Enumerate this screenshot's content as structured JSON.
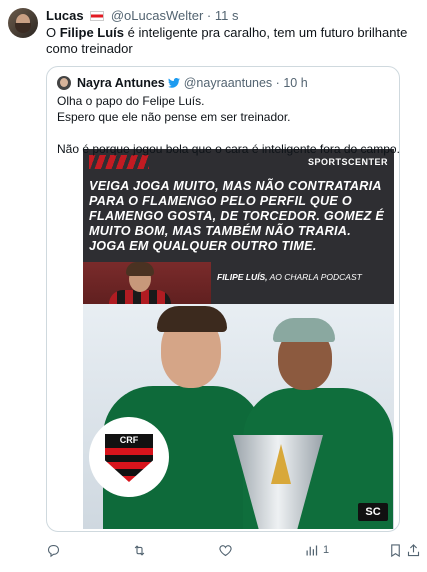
{
  "tweet": {
    "author_name": "Lucas",
    "author_handle": "@oLucasWelter",
    "separator": "·",
    "time": "11 s",
    "text_pre": "O ",
    "text_bold": "Filipe Luís",
    "text_post": " é inteligente pra caralho, tem um futuro brilhante como treinador"
  },
  "quoted": {
    "author_name": "Nayra Antunes",
    "author_handle": "@nayraantunes",
    "separator": "·",
    "time": "10 h",
    "lines": [
      "Olha o papo do Felipe Luís.",
      "Espero que ele não pense em ser treinador.",
      "Não é porque jogou bola que o cara é inteligente fora do campo."
    ],
    "media": {
      "brand": "SPORTSCENTER",
      "quote_lines": [
        "VEIGA JOGA MUITO, MAS NÃO CONTRATARIA",
        "PARA O FLAMENGO PELO PERFIL QUE O",
        "FLAMENGO GOSTA, DE TORCEDOR. GOMEZ É",
        "MUITO BOM, MAS TAMBÉM NÃO TRARIA.",
        "JOGA EM QUALQUER OUTRO TIME."
      ],
      "attribution_name": "FILIPE LUÍS,",
      "attribution_rest": " AO CHARLA PODCAST",
      "crest_text": "CRF",
      "corner_badge": "SC"
    }
  },
  "actions": {
    "views_count": "1"
  }
}
